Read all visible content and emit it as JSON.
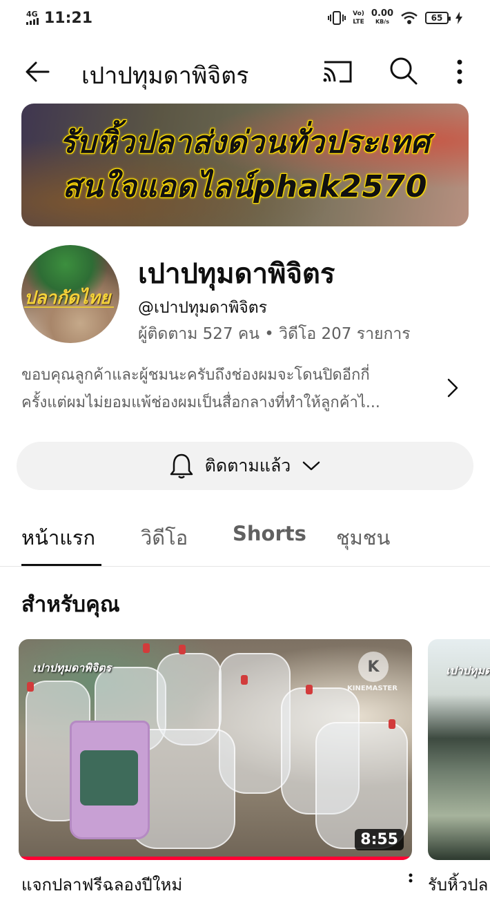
{
  "status_bar": {
    "network": "4G",
    "time": "11:21",
    "speed_value": "0.00",
    "speed_unit": "KB/s",
    "lte_label": "LTE",
    "battery": "65"
  },
  "app_bar": {
    "title": "เปาปทุมดาพิจิตร",
    "icons": [
      "back-arrow-icon",
      "cast-icon",
      "search-icon",
      "more-vert-icon"
    ]
  },
  "banner": {
    "line1": "รับหิ้วปลาส่งด่วนทั่วประเทศ",
    "line2": "สนใจแอดไลน์phak2570"
  },
  "avatar": {
    "text": "ปลากัดไทย"
  },
  "channel": {
    "name": "เปาปทุมดาพิจิตร",
    "handle": "@เปาปทุมดาพิจิตร",
    "stats": "ผู้ติดตาม 527 คน • วิดีโอ 207 รายการ"
  },
  "description": {
    "line1": "ขอบคุณลูกค้าและผู้ชมนะครับถึงช่องผมจะโดนปิดอีกกี่",
    "line2": "ครั้งแต่ผมไม่ยอมแพ้ช่องผมเป็นสื่อกลางที่ทำให้ลูกค้าไ..."
  },
  "subscribe_button": {
    "label": "ติดตามแล้ว"
  },
  "tabs": [
    {
      "label": "หน้าแรก",
      "active": true
    },
    {
      "label": "วิดีโอ",
      "active": false
    },
    {
      "label": "Shorts",
      "active": false
    },
    {
      "label": "ชุมชน",
      "active": false
    }
  ],
  "section": {
    "title": "สำหรับคุณ"
  },
  "videos": [
    {
      "overlay_label": "เปาปทุมดาพิจิตร",
      "watermark": "KINEMASTER",
      "duration": "8:55",
      "title": "แจกปลาฟรีฉลองปีใหม่"
    },
    {
      "overlay_label": "เปาปทุมดา",
      "title": "รับหิ้วปล"
    }
  ],
  "colors": {
    "progress": "#ff0033",
    "tab_indicator": "#0f0f0f",
    "button_bg": "#f2f2f2"
  }
}
